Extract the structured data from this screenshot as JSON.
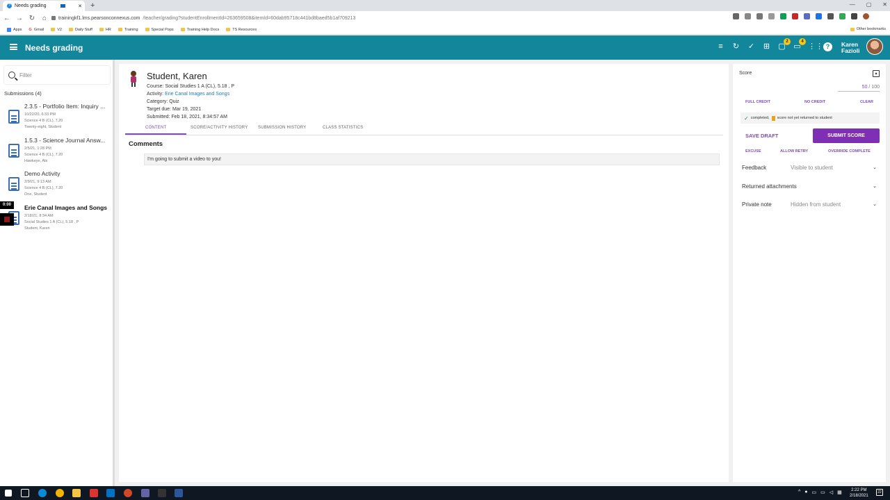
{
  "browser": {
    "tab_title": "Needs grading",
    "url_host": "trainingkf1.lms.pearsonconnexus.com",
    "url_path": "/teacher/grading?studentEnrollmentId=263659508&itemId=60dab95718c441bd8baed5b1af709213",
    "bookmarks": [
      "Apps",
      "Gmail",
      "V2",
      "Daily Stuff",
      "HR",
      "Training",
      "Special Pops",
      "Training Help Docs",
      "TS Resources"
    ],
    "other_bookmarks": "Other bookmarks"
  },
  "appbar": {
    "title": "Needs grading",
    "badge_one": "2",
    "badge_two": "4",
    "user_first": "Karen",
    "user_last": "Fazioli"
  },
  "sidebar": {
    "filter_placeholder": "Filter",
    "count_label": "Submissions (4)",
    "items": [
      {
        "title": "2.3.5 - Portfolio Item: Inquiry ...",
        "date": "10/22/20, 6:33 PM",
        "course": "Science 4 B (CL), 7.20",
        "student": "Twenty-eight, Student"
      },
      {
        "title": "1.5.3 - Science Journal Answ...",
        "date": "2/5/21, 1:28 PM",
        "course": "Science 4 B (CL), 7.20",
        "student": "Hawkeye, Abi"
      },
      {
        "title": "Demo Activity",
        "date": "2/9/21, 9:13 AM",
        "course": "Science 4 B (CL), 7.20",
        "student": "One, Student"
      },
      {
        "title": "Erie Canal Images and Songs",
        "date": "2/18/21, 8:34 AM",
        "course": "Social Studies 1 A (CL), 5.18 , P",
        "student": "Student, Karen"
      }
    ],
    "timer": "0:00"
  },
  "student": {
    "name": "Student, Karen",
    "course_label": "Course:",
    "course": "Social Studies 1 A (CL), 5.18 , P",
    "activity_label": "Activity:",
    "activity": "Erie Canal Images and Songs",
    "category": "Category: Quiz",
    "target_due": "Target due: Mar 19, 2021",
    "submitted": "Submitted: Feb 18, 2021, 8:34:57 AM"
  },
  "tabs": [
    "CONTENT",
    "SCORE/ACTIVITY HISTORY",
    "SUBMISSION HISTORY",
    "CLASS STATISTICS"
  ],
  "comments": {
    "heading": "Comments",
    "text": "I'm going to submit a video to you!"
  },
  "score": {
    "label": "Score",
    "value": "50",
    "max": "/ 100",
    "full_credit": "FULL CREDIT",
    "no_credit": "NO CREDIT",
    "clear": "CLEAR",
    "status_completed": "completed,",
    "status_returned": "score not yet returned to student",
    "save_draft": "SAVE DRAFT",
    "submit": "SUBMIT SCORE",
    "excuse": "EXCUSE",
    "allow_retry": "ALLOW RETRY",
    "override": "OVERRIDE COMPLETE",
    "feedback": "Feedback",
    "feedback_hint": "Visible to student",
    "returned_attachments": "Returned attachments",
    "private_note": "Private note",
    "private_hint": "Hidden from student"
  },
  "taskbar": {
    "time": "2:22 PM",
    "date": "2/18/2021",
    "notif": "22"
  }
}
